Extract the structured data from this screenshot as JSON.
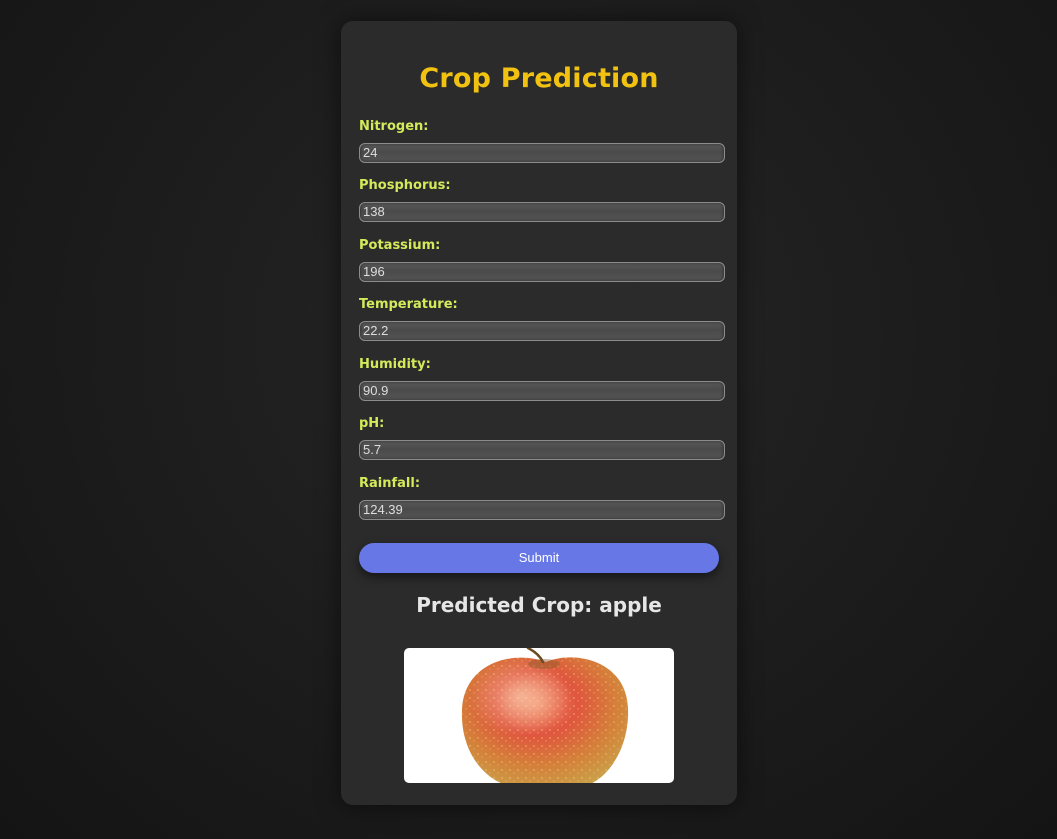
{
  "page": {
    "title": "Crop Prediction"
  },
  "form": {
    "fields": [
      {
        "label": "Nitrogen:",
        "value": "24"
      },
      {
        "label": "Phosphorus:",
        "value": "138"
      },
      {
        "label": "Potassium:",
        "value": "196"
      },
      {
        "label": "Temperature:",
        "value": "22.2"
      },
      {
        "label": "Humidity:",
        "value": "90.9"
      },
      {
        "label": "pH:",
        "value": "5.7"
      },
      {
        "label": "Rainfall:",
        "value": "124.39"
      }
    ],
    "submit_label": "Submit"
  },
  "result": {
    "text": "Predicted Crop: apple",
    "image_icon": "apple-image"
  },
  "colors": {
    "background": "#1c1c1c",
    "card": "#2b2b2b",
    "title": "#f2c211",
    "label": "#d4ea5a",
    "button": "#6778e6",
    "result_text": "#e6e6e6"
  }
}
